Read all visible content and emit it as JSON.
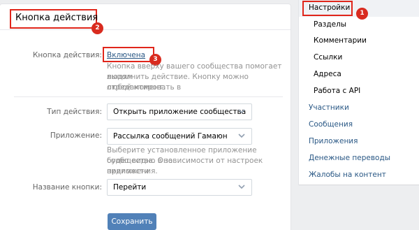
{
  "header": {
    "title": "Кнопка действия"
  },
  "markers": {
    "one": "1",
    "two": "2",
    "three": "3"
  },
  "action_button": {
    "label": "Кнопка действия:",
    "value": "Включена",
    "hint_lines": [
      "Кнопка вверху вашего сообщества помогает людям",
      "выполнить действие. Кнопку можно отредактировать в",
      "любой момент."
    ]
  },
  "action_type": {
    "label": "Тип действия:",
    "value": "Открыть приложение сообщества"
  },
  "application": {
    "label": "Приложение:",
    "value": "Рассылка сообщений  Гамаюн",
    "hint_lines": [
      "Выберите установленное приложение сообщества. Оно",
      "будет видно в зависимости от настроек видимости",
      "приложения."
    ]
  },
  "button_name": {
    "label": "Название кнопки:",
    "value": "Перейти"
  },
  "save_button": {
    "label": "Сохранить"
  },
  "sidebar": {
    "active": "Настройки",
    "sub_items": [
      "Разделы",
      "Комментарии",
      "Ссылки",
      "Адреса",
      "Работа с API"
    ],
    "links": [
      "Участники",
      "Сообщения",
      "Приложения",
      "Денежные переводы",
      "Жалобы на контент"
    ]
  },
  "colors": {
    "accent": "#5181b8",
    "link": "#2a5885",
    "highlight": "#e0261b"
  },
  "icons": {
    "select_arrow": "chevron-down-icon"
  }
}
